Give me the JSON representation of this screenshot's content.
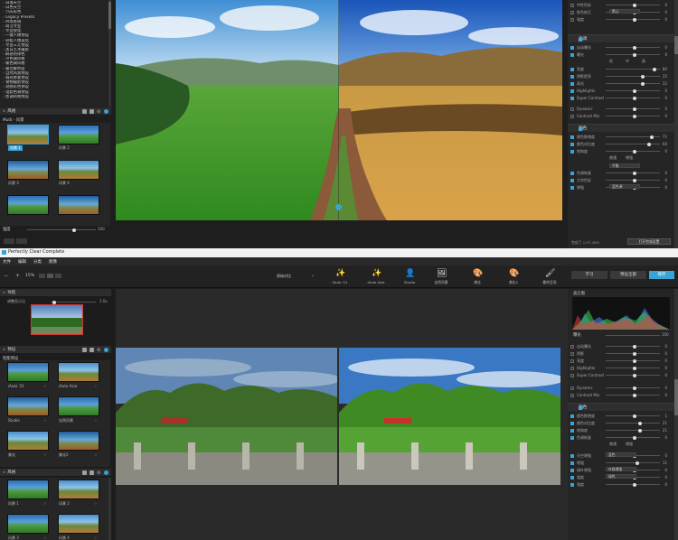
{
  "top": {
    "tree_items": [
      "日落天空",
      "白色天空",
      "节庆彩色",
      "Legacy Presets",
      "AI场景调",
      "简洁专业",
      "专业锐化",
      "一键人像预设",
      "轻松人像美化",
      "专业三元预设",
      "黑白艺术摄影",
      "鲜艳的绿色",
      "冷色调风格",
      "暖色调风格",
      "最佳解析度",
      "自然风景预设",
      "弱光修复预设",
      "食物摄影预设",
      "动感彩色预设",
      "电影色调预设",
      "影调风格预设"
    ],
    "presets_header": "风格",
    "presets_sub": "Multi - 风景",
    "thumbs": [
      "风景 1",
      "风景 2",
      "风景 3",
      "风景 4",
      "风景 5",
      "风景 6"
    ],
    "strength_label": "强度",
    "strength_value": "100",
    "right_top_rows": [
      {
        "label": "中性色彩",
        "value": "0"
      },
      {
        "label": "肤色校正",
        "value": "0"
      },
      {
        "label": "强度",
        "value": "0"
      }
    ],
    "right_top_dropdown": "默认",
    "sec_light": "亮调",
    "light_rows": [
      {
        "label": "自动曝光",
        "value": "0"
      },
      {
        "label": "曝光",
        "value": "0"
      },
      {
        "label": "亮度",
        "value": "80"
      },
      {
        "label": "阴影提亮",
        "value": "35"
      },
      {
        "label": "高光",
        "value": "32"
      },
      {
        "label": "Highlights",
        "value": "0"
      },
      {
        "label": "Super Contrast",
        "value": "0"
      }
    ],
    "light_extra": [
      {
        "label": "Dynamic",
        "value": "0"
      },
      {
        "label": "Contrast Mix",
        "value": "0"
      }
    ],
    "light_opts": [
      "低",
      "中",
      "高"
    ],
    "sec_color": "颜色",
    "color_rows": [
      {
        "label": "颜色鲜艳度",
        "value": "71"
      },
      {
        "label": "颜色对比度",
        "value": "60"
      },
      {
        "label": "饱和度",
        "value": "0"
      }
    ],
    "color_opts": [
      "普通",
      "增强"
    ],
    "color_rows2": [
      {
        "label": "色调恢复",
        "value": "0"
      },
      {
        "label": "大宗色彩",
        "value": "0"
      },
      {
        "label": "增强",
        "value": "0"
      }
    ],
    "color_dropdown": "平衡",
    "color_dropdown2": "蓝色调",
    "bottom_left": "完成了-1.57-40%",
    "bottom_btn": "打开完成设置",
    "bottom_btn2": "添加到预设"
  },
  "bot": {
    "app_title": "Perfectly Clear Complete",
    "menu": [
      "文件",
      "编辑",
      "分类",
      "图像"
    ],
    "zoom": "15%",
    "compare_label": "原始对比",
    "tools": [
      {
        "glyph": "✨",
        "label": "iAuto '21"
      },
      {
        "glyph": "✨",
        "label": "iAuto Asia"
      },
      {
        "glyph": "👤",
        "label": "Studio"
      },
      {
        "glyph": "🖼",
        "label": "自然风景"
      },
      {
        "glyph": "🎨",
        "label": "美化"
      },
      {
        "glyph": "🎨",
        "label": "美化2"
      },
      {
        "glyph": "🖌",
        "label": "最终呈现"
      }
    ],
    "tabs": [
      "学习",
      "预设全部",
      "保存"
    ],
    "nav_header": "导航",
    "nav_label": "调整显示比",
    "nav_value": "1.0x",
    "presets_header": "预设",
    "preset_group": "智能预设",
    "thumbs": [
      "iAuto '21",
      "iAuto Asia",
      "Studio",
      "自然风景",
      "美化",
      "美化2"
    ],
    "style_header": "风格",
    "style_thumbs": [
      "风景 1",
      "风景 2",
      "风景 3",
      "风景 4"
    ],
    "histogram_label": "直方图",
    "exposure_label": "曝光",
    "exposure_value": "100",
    "rows": [
      {
        "label": "自动曝光",
        "value": "0"
      },
      {
        "label": "阴影",
        "value": "0"
      },
      {
        "label": "亮度",
        "value": "0"
      },
      {
        "label": "Highlights",
        "value": "0"
      },
      {
        "label": "Super Contrast",
        "value": "0"
      }
    ],
    "rows2": [
      {
        "label": "Dynamic",
        "value": "0"
      },
      {
        "label": "Contrast Mix",
        "value": "0"
      }
    ],
    "sec_color": "颜色",
    "color_rows": [
      {
        "label": "颜色鲜艳度",
        "value": "1"
      },
      {
        "label": "颜色对比度",
        "value": "21"
      },
      {
        "label": "饱和度",
        "value": "21"
      },
      {
        "label": "色调恢复",
        "value": "0"
      }
    ],
    "color_opts": [
      "普通",
      "增强"
    ],
    "rows3": [
      {
        "label": "天空增强",
        "value": "0"
      },
      {
        "label": "增强",
        "value": "11"
      },
      {
        "label": "绿叶增强",
        "value": "0"
      },
      {
        "label": "强度",
        "value": "0"
      },
      {
        "label": "强度",
        "value": "0"
      }
    ],
    "dd1": "蓝色",
    "dd2": "叶绿增强",
    "dd3": "绿色"
  },
  "colors": {
    "accent": "#3aa3d6"
  }
}
